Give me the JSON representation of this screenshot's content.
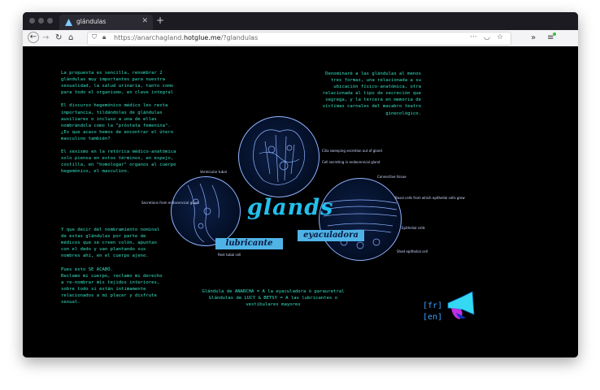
{
  "browser": {
    "tab_title": "glándulas",
    "url_host": "https://anarchagland.",
    "url_domain": "hotglue.me",
    "url_path": "/?glandulas"
  },
  "icons": [
    "back-icon",
    "forward-icon",
    "reload-icon",
    "home-icon",
    "shield-icon",
    "lock-icon",
    "more-icon",
    "pocket-icon",
    "star-icon",
    "overflow-icon",
    "menu-icon"
  ],
  "page": {
    "text_top_left": "La propuesta es sencilla, renombrar 2\nglándulas muy importantes para nuestra\nsexualidad, la salud urinaria, tanto como\npara todo el organismo, en clave integral\n\nEl discurso hegemónico médico les resta\nimportancia, tildándolas de glándulas\nauxiliares o incluso a una de ellas\nnombrándola como la \"próstata femenina\".\n¿Es que acaso hemos de encontrar el útero\nmasculino también?\n\nEl sexismo en la retórica médico-anatómica\nsolo piensa en estos términos, en espejo,\ncostilla, en \"homologar\" organos al cuerpo\nhegemónico, el masculino.",
    "text_top_right": "Denominaré a las glándulas al menos\ntres formas, una relacionada a su\nubicación físico-anatómica, otra\nrelacionada al tipo de secreción que\nsegrega, y la tercera en memoria de\nvíctimas carnales del macabro teatro\nginecológico.",
    "text_bottom_left": "Y que decir del nombramiento nominal\nde estas glándulas por parte de\nmédicos que se creen colón, apuntan\ncon el dedo y van plantando sus\nnombres ahí, en el cuerpo ajeno.\n\nPues esto SE ACABÓ.\nReclamo mi cuerpo, reclamo mi derecho\na re-nombrar mis tejidos interiores,\nsobre todo si están intimamente\nrelacionados a mi placer y disfrute\nsexual.",
    "text_bottom_center": "Glándula de ANARCHA = A la eyaculadora ó parauretral\nGlándulas de LUCY & BETSY = A las lubricantes o\nvestibulares mayores",
    "title": "glands",
    "label_lubricante": "lubricante",
    "label_eyaculadora": "eyaculadora",
    "captions": {
      "cilia": "Cilia sweeping\nsecretion out of gland",
      "cell_secreting": "Cell secreting in\nendocervical gland",
      "vermicular": "Vermicular tubal",
      "secretions": "Secretions from\nendocervical gland",
      "rest_tubal": "Rest tubal cell",
      "connective": "Connective tissue",
      "basal": "Basal cells from which\nepithelial cells grow",
      "epithelial": "Epithelial cells",
      "shed": "Shed epithelial cell"
    },
    "lang_fr": "[fr]",
    "lang_en": "[en]"
  },
  "colors": {
    "text": "#35e0c2",
    "title": "#22c0ee",
    "label_bg": "#4fb3e6",
    "lang": "#3aa0ff"
  }
}
